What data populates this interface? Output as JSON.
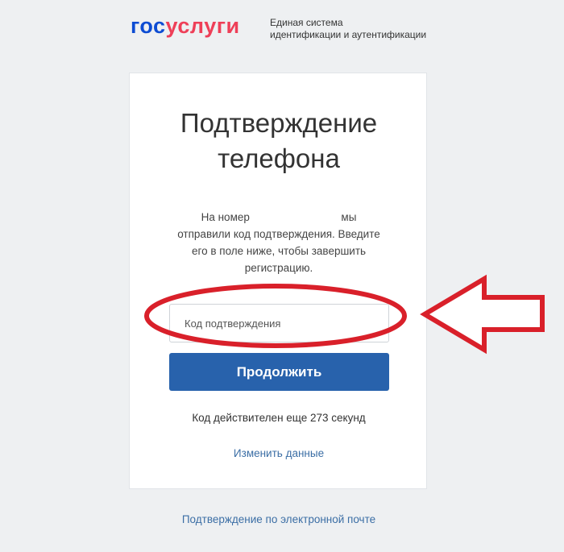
{
  "header": {
    "logo_part1": "гос",
    "logo_part2": "услуги",
    "tagline_line1": "Единая система",
    "tagline_line2": "идентификации и аутентификации"
  },
  "card": {
    "title_line1": "Подтверждение",
    "title_line2": "телефона",
    "desc_prefix": "На номер",
    "desc_suffix": "мы",
    "desc_line2": "отправили код подтверждения. Введите",
    "desc_line3": "его в поле ниже, чтобы завершить",
    "desc_line4": "регистрацию.",
    "code_input_placeholder": "Код подтверждения",
    "code_input_value": "",
    "continue_label": "Продолжить",
    "timer_text": "Код действителен еще 273 секунд",
    "change_data_label": "Изменить данные"
  },
  "footer": {
    "email_link_label": "Подтверждение по электронной почте"
  },
  "colors": {
    "brand_blue": "#0d4cd3",
    "brand_red": "#ee3f58",
    "button_blue": "#2862ac",
    "link_blue": "#3b6ea5",
    "annotation_red": "#d9202a"
  },
  "icons": [
    "annotation-arrow-icon",
    "annotation-ellipse"
  ]
}
